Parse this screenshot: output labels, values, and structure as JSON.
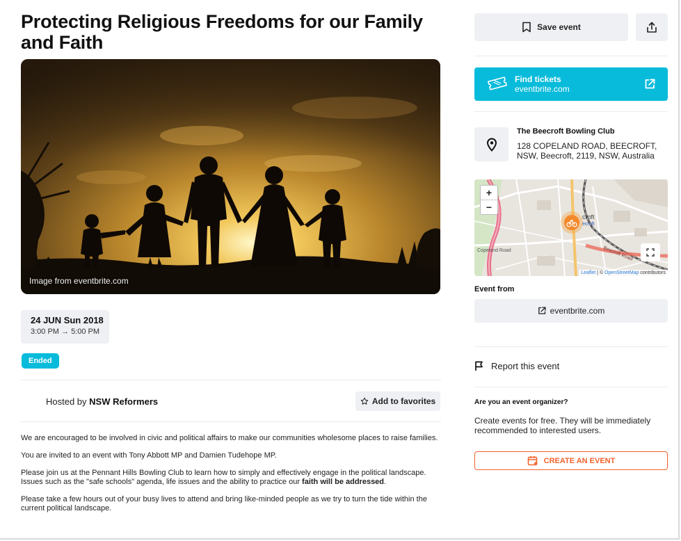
{
  "event": {
    "title": "Protecting Religious Freedoms for our Family and Faith",
    "image_caption": "Image from eventbrite.com",
    "date": "24 JUN Sun 2018",
    "time": "3:00 PM → 5:00 PM",
    "status": "Ended",
    "hosted_prefix": "Hosted by ",
    "host": "NSW Reformers",
    "favorite_label": "Add to favorites",
    "description": {
      "p1": "We are encouraged to be involved in civic and political affairs to make our communities wholesome places to raise families.",
      "p2": "You are invited to an event with Tony Abbott MP and Damien Tudehope MP.",
      "p3_a": "Please join us at the Pennant Hills Bowling Club to learn how to simply and effectively engage in the political landscape. Issues such as the \"safe schools\" agenda, life issues and the ability to practice our ",
      "p3_b": "faith will be addressed",
      "p3_c": ".",
      "p4": "Please take a few hours out of your busy lives to attend and bring like-minded people as we try to turn the tide within the current political landscape."
    }
  },
  "sidebar": {
    "save_label": "Save event",
    "tickets_title": "Find tickets",
    "tickets_site": "eventbrite.com",
    "venue_name": "The Beecroft Bowling Club",
    "venue_address": "128 COPELAND ROAD, BEECROFT, NSW, Beecroft, 2119, NSW, Australia",
    "map": {
      "zoom_in": "+",
      "zoom_out": "−",
      "label_road": "Copeland Road",
      "label_place": "croft",
      "label_place2": "ecroft",
      "label_rail": "Beecroft Road",
      "attribution_leaflet": "Leaflet",
      "attribution_sep": " | © ",
      "attribution_osm": "OpenStreetMap",
      "attribution_tail": " contributors"
    },
    "event_from_label": "Event from",
    "event_from_site": "eventbrite.com",
    "report_label": "Report this event",
    "organizer_question": "Are you an event organizer?",
    "organizer_text": "Create events for free. They will be immediately recommended to interested users.",
    "create_label": "CREATE AN EVENT"
  },
  "colors": {
    "accent_cyan": "#08bbdb",
    "accent_orange": "#f2622b",
    "button_bg": "#eef0f3"
  }
}
